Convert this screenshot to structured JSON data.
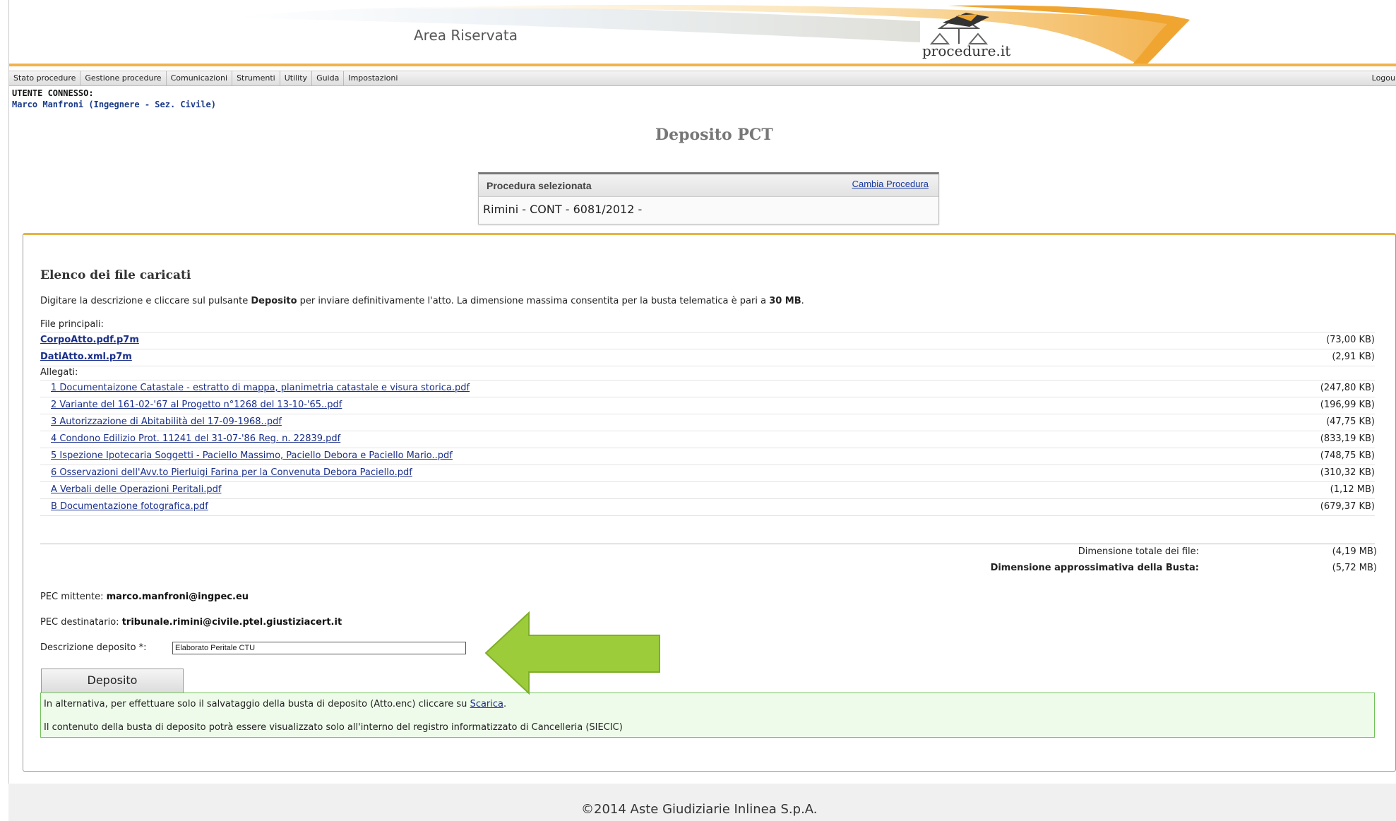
{
  "header": {
    "area_title": "Area Riservata",
    "logo_text": "procedure.it"
  },
  "menu": {
    "items": [
      "Stato procedure",
      "Gestione procedure",
      "Comunicazioni",
      "Strumenti",
      "Utility",
      "Guida",
      "Impostazioni"
    ],
    "logout": "Logou"
  },
  "user": {
    "label": "UTENTE CONNESSO:",
    "name": "Marco Manfroni (Ingegnere - Sez. Civile)"
  },
  "page_title": "Deposito PCT",
  "procedure": {
    "label": "Procedura selezionata",
    "change_link": "Cambia Procedura",
    "value": "Rimini - CONT - 6081/2012 -"
  },
  "files": {
    "title": "Elenco dei file caricati",
    "instruction_pre": "Digitare la descrizione e cliccare sul pulsante ",
    "instruction_bold": "Deposito",
    "instruction_mid": " per inviare definitivamente l'atto. La dimensione massima consentita per la busta telematica è pari a ",
    "instruction_max": "30 MB",
    "instruction_end": ".",
    "main_label": "File principali:",
    "main": [
      {
        "name": "CorpoAtto.pdf.p7m",
        "size": "(73,00 KB)"
      },
      {
        "name": "DatiAtto.xml.p7m",
        "size": "(2,91 KB)"
      }
    ],
    "attachments_label": "Allegati:",
    "attachments": [
      {
        "name": "1 Documentaizone Catastale - estratto di mappa, planimetria catastale e visura storica.pdf",
        "size": "(247,80 KB)"
      },
      {
        "name": "2 Variante del 161-02-'67 al Progetto n°1268 del 13-10-'65..pdf",
        "size": "(196,99 KB)"
      },
      {
        "name": "3 Autorizzazione di Abitabilità del 17-09-1968..pdf",
        "size": "(47,75 KB)"
      },
      {
        "name": "4 Condono Edilizio Prot. 11241 del 31-07-'86 Reg. n. 22839.pdf",
        "size": "(833,19 KB)"
      },
      {
        "name": "5 Ispezione Ipotecaria Soggetti - Paciello Massimo, Paciello Debora e Paciello Mario..pdf",
        "size": "(748,75 KB)"
      },
      {
        "name": "6 Osservazioni dell'Avv.to Pierluigi Farina per la Convenuta Debora Paciello.pdf",
        "size": "(310,32 KB)"
      },
      {
        "name": "A Verbali delle Operazioni Peritali.pdf",
        "size": "(1,12 MB)"
      },
      {
        "name": "B Documentazione fotografica.pdf",
        "size": "(679,37 KB)"
      }
    ],
    "total_label": "Dimensione totale dei file:",
    "total_value": "(4,19 MB)",
    "envelope_label": "Dimensione approssimativa della Busta:",
    "envelope_value": "(5,72 MB)"
  },
  "pec": {
    "sender_label": "PEC mittente: ",
    "sender": "marco.manfroni@ingpec.eu",
    "recipient_label": "PEC destinatario: ",
    "recipient": "tribunale.rimini@civile.ptel.giustiziacert.it"
  },
  "deposit": {
    "desc_label": "Descrizione deposito *:",
    "desc_value": "Elaborato Peritale CTU",
    "button": "Deposito"
  },
  "info": {
    "line1_pre": "In alternativa, per effettuare solo il salvataggio della busta di deposito (Atto.enc) cliccare su ",
    "line1_link": "Scarica",
    "line1_end": ".",
    "line2": "Il contenuto della busta di deposito potrà essere visualizzato solo all'interno del registro informatizzato di Cancelleria (SIECIC)"
  },
  "colors": {
    "accent_orange": "#f0a531",
    "arrow_green": "#9ccc3a",
    "panel_top": "#e3b445",
    "link": "#1a2f8a"
  },
  "footer": "©2014 Aste Giudiziarie Inlinea S.p.A."
}
